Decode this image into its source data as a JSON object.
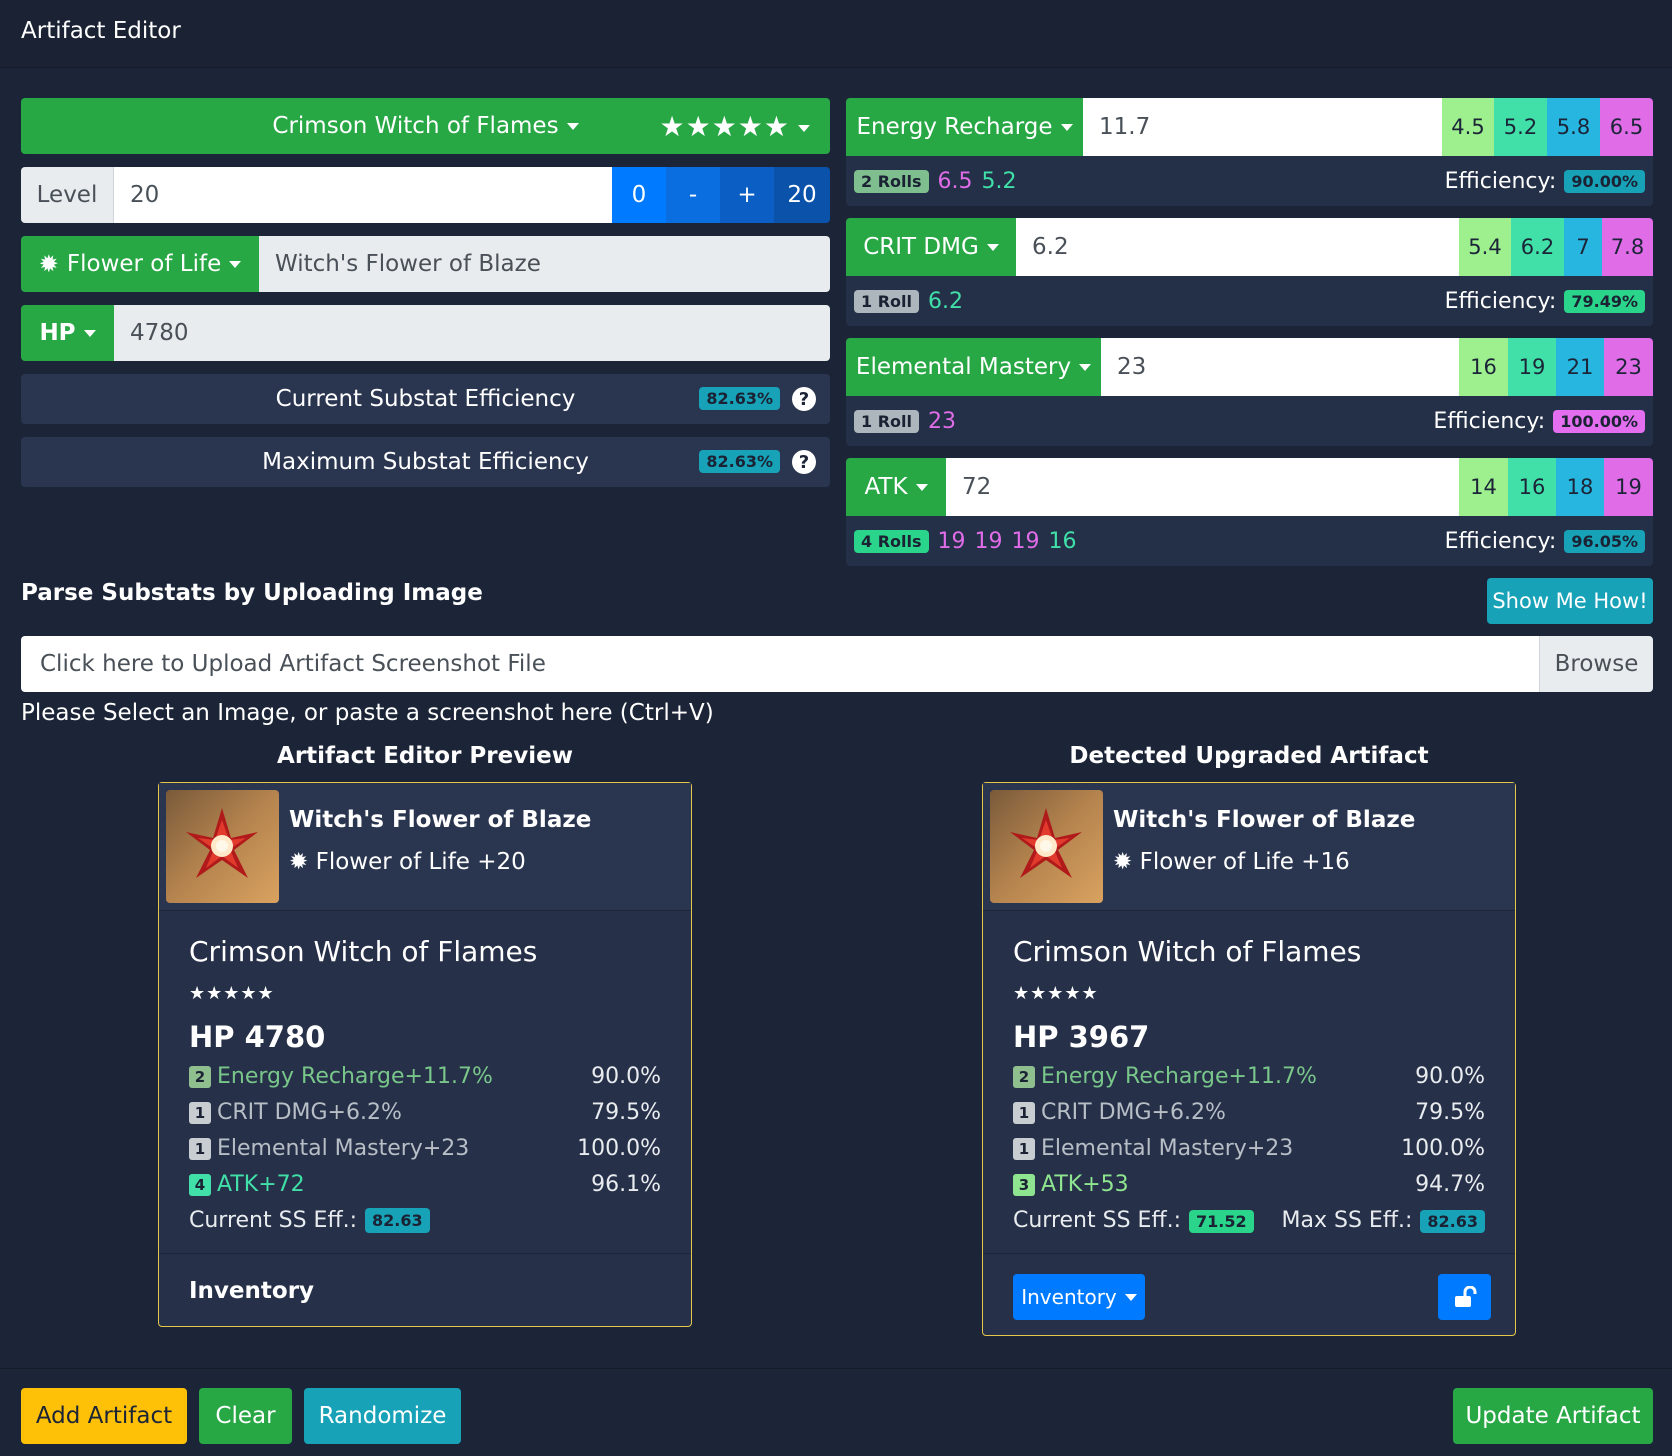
{
  "header": {
    "title": "Artifact Editor"
  },
  "editor": {
    "set_name": "Crimson Witch of Flames",
    "stars": "★★★★★",
    "level_label": "Level",
    "level_value": "20",
    "level_buttons": [
      "0",
      "-",
      "+",
      "20"
    ],
    "slot_label": "Flower of Life",
    "artifact_name": "Witch's Flower of Blaze",
    "main_stat_label": "HP",
    "main_stat_value": "4780",
    "current_eff_label": "Current Substat Efficiency",
    "current_eff_value": "82.63%",
    "max_eff_label": "Maximum Substat Efficiency",
    "max_eff_value": "82.63%",
    "help_glyph": "?"
  },
  "substats": [
    {
      "name": "Energy Recharge",
      "value": "11.7",
      "rolls_options": [
        "4.5",
        "5.2",
        "5.8",
        "6.5"
      ],
      "rolls_label": "2 Rolls",
      "rolls": [
        {
          "v": "6.5",
          "c": "pink"
        },
        {
          "v": "5.2",
          "c": "green"
        }
      ],
      "efficiency_label": "Efficiency:",
      "efficiency": "90.00%",
      "eff_color": "info",
      "rolls_badge_color": "green"
    },
    {
      "name": "CRIT DMG",
      "value": "6.2",
      "rolls_options": [
        "5.4",
        "6.2",
        "7",
        "7.8"
      ],
      "rolls_label": "1 Roll",
      "rolls": [
        {
          "v": "6.2",
          "c": "green"
        }
      ],
      "efficiency_label": "Efficiency:",
      "efficiency": "79.49%",
      "eff_color": "success",
      "rolls_badge_color": "grey"
    },
    {
      "name": "Elemental Mastery",
      "value": "23",
      "rolls_options": [
        "16",
        "19",
        "21",
        "23"
      ],
      "rolls_label": "1 Roll",
      "rolls": [
        {
          "v": "23",
          "c": "pink"
        }
      ],
      "efficiency_label": "Efficiency:",
      "efficiency": "100.00%",
      "eff_color": "pink",
      "rolls_badge_color": "grey"
    },
    {
      "name": "ATK",
      "value": "72",
      "rolls_options": [
        "14",
        "16",
        "18",
        "19"
      ],
      "rolls_label": "4 Rolls",
      "rolls": [
        {
          "v": "19",
          "c": "pink"
        },
        {
          "v": "19",
          "c": "pink"
        },
        {
          "v": "19",
          "c": "pink"
        },
        {
          "v": "16",
          "c": "green"
        }
      ],
      "efficiency_label": "Efficiency:",
      "efficiency": "96.05%",
      "eff_color": "info",
      "rolls_badge_color": "teal"
    }
  ],
  "upload": {
    "heading": "Parse Substats by Uploading Image",
    "show_me_how": "Show Me How!",
    "placeholder": "Click here to Upload Artifact Screenshot File",
    "browse": "Browse",
    "hint": "Please Select an Image, or paste a screenshot here (Ctrl+V)"
  },
  "preview_left": {
    "heading": "Artifact Editor Preview",
    "name": "Witch's Flower of Blaze",
    "slot": "Flower of Life +20",
    "set": "Crimson Witch of Flames",
    "stars": "★★★★★",
    "main": "HP 4780",
    "subs": [
      {
        "n": "2",
        "text": "Energy Recharge+11.7%",
        "eff": "90.0%",
        "c": "green"
      },
      {
        "n": "1",
        "text": "CRIT DMG+6.2%",
        "eff": "79.5%",
        "c": "grey"
      },
      {
        "n": "1",
        "text": "Elemental Mastery+23",
        "eff": "100.0%",
        "c": "grey"
      },
      {
        "n": "4",
        "text": "ATK+72",
        "eff": "96.1%",
        "c": "teal"
      }
    ],
    "cur_label": "Current SS Eff.:",
    "cur_value": "82.63",
    "footer": "Inventory"
  },
  "preview_right": {
    "heading": "Detected Upgraded Artifact",
    "name": "Witch's Flower of Blaze",
    "slot": "Flower of Life +16",
    "set": "Crimson Witch of Flames",
    "stars": "★★★★★",
    "main": "HP 3967",
    "subs": [
      {
        "n": "2",
        "text": "Energy Recharge+11.7%",
        "eff": "90.0%",
        "c": "green"
      },
      {
        "n": "1",
        "text": "CRIT DMG+6.2%",
        "eff": "79.5%",
        "c": "grey"
      },
      {
        "n": "1",
        "text": "Elemental Mastery+23",
        "eff": "100.0%",
        "c": "grey"
      },
      {
        "n": "3",
        "text": "ATK+53",
        "eff": "94.7%",
        "c": "lg"
      }
    ],
    "cur_label": "Current SS Eff.:",
    "cur_value": "71.52",
    "max_label": "Max SS Eff.:",
    "max_value": "82.63",
    "footer": "Inventory"
  },
  "actions": {
    "add": "Add Artifact",
    "clear": "Clear",
    "randomize": "Randomize",
    "update": "Update Artifact"
  },
  "icons": {
    "flower": "flower-icon",
    "lock": "unlock-icon",
    "help": "help-icon"
  },
  "colors": {
    "green": "#28a745",
    "info": "#17a2b8",
    "blue": "#007bff",
    "yellow": "#ffc107",
    "bg": "#1c2537"
  }
}
